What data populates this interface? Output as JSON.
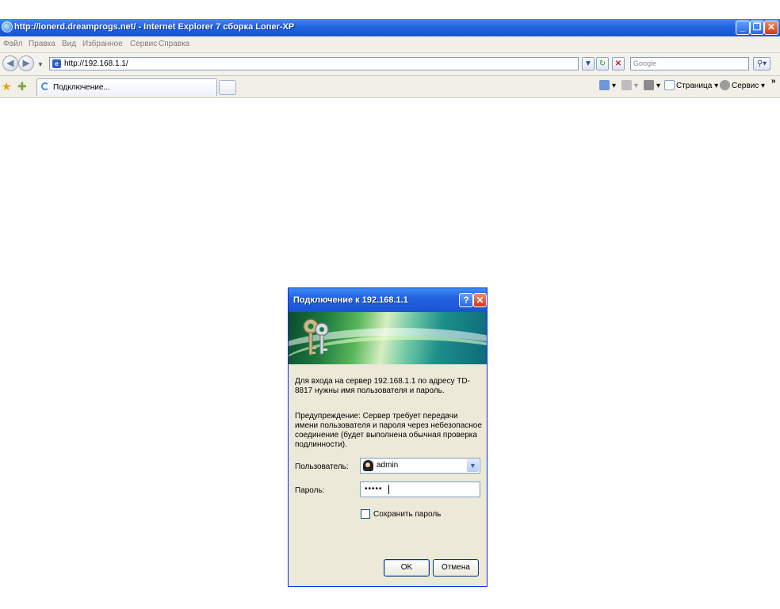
{
  "browser": {
    "title": "http://lonerd.dreamprogs.net/ - Internet Explorer 7 сборка Loner-XP",
    "menu": [
      "Файл",
      "Правка",
      "Вид",
      "Избранное",
      "Сервис",
      "Справка"
    ],
    "address": "http://192.168.1.1/",
    "search_placeholder": "Google",
    "tab_label": "Подключение...",
    "commands": {
      "page": "Страница",
      "tools": "Сервис"
    },
    "chevron": "»"
  },
  "dialog": {
    "title": "Подключение к 192.168.1.1",
    "message": "Для входа на сервер 192.168.1.1 по адресу TD-8817 нужны имя пользователя и пароль.",
    "warning": "Предупреждение: Сервер требует передачи имени пользователя и пароля через небезопасное соединение (будет выполнена обычная проверка подлинности).",
    "user_label": "Пользователь:",
    "user_value": "admin",
    "password_label": "Пароль:",
    "password_value": "•••••",
    "remember_label": "Сохранить пароль",
    "remember_checked": false,
    "ok_label": "OK",
    "cancel_label": "Отмена"
  }
}
